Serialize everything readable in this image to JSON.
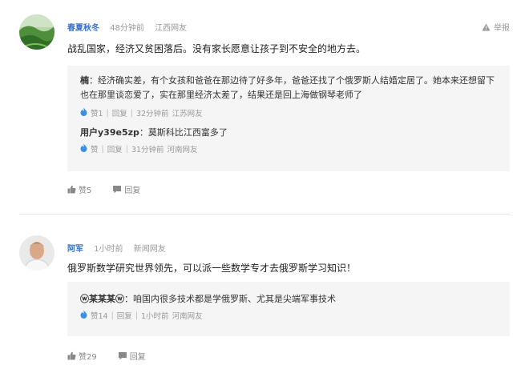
{
  "comments": [
    {
      "username": "春夏秋冬",
      "time": "48分钟前",
      "location": "江西网友",
      "report_label": "举报",
      "content": "战乱国家，经济又贫困落后。没有家长愿意让孩子到不安全的地方去。",
      "replies": [
        {
          "author": "楠",
          "text": "：经济确实差，有个女孩和爸爸在那边待了好多年，爸爸还找了个俄罗斯人结婚定居了。她本来还想留下也在那里谈恋爱了，实在那里经济太差了，结果还是回上海做钢琴老师了",
          "like_label": "赞1",
          "reply_label": "回复",
          "time": "32分钟前",
          "location": "江苏网友"
        },
        {
          "author": "用户y39e5zp",
          "text": "：莫斯科比江西富多了",
          "like_label": "赞",
          "reply_label": "回复",
          "time": "31分钟前",
          "location": "河南网友"
        }
      ],
      "like_label": "赞5",
      "reply_label": "回复"
    },
    {
      "username": "阿军",
      "time": "1小时前",
      "location": "新闻网友",
      "content": "俄罗斯数学研究世界领先，可以派一些数学专才去俄罗斯学习知识！",
      "replies": [
        {
          "author": "ⓦ某某某ⓦ",
          "text": "：咱国内很多技术都是学俄罗斯、尤其是尖端军事技术",
          "like_label": "赞14",
          "reply_label": "回复",
          "time": "1小时前",
          "location": "河南网友"
        }
      ],
      "like_label": "赞29",
      "reply_label": "回复"
    }
  ],
  "colors": {
    "username": "#3b73c9",
    "flame": "#3a8ee6",
    "reply_bg": "#f5f5f5"
  }
}
